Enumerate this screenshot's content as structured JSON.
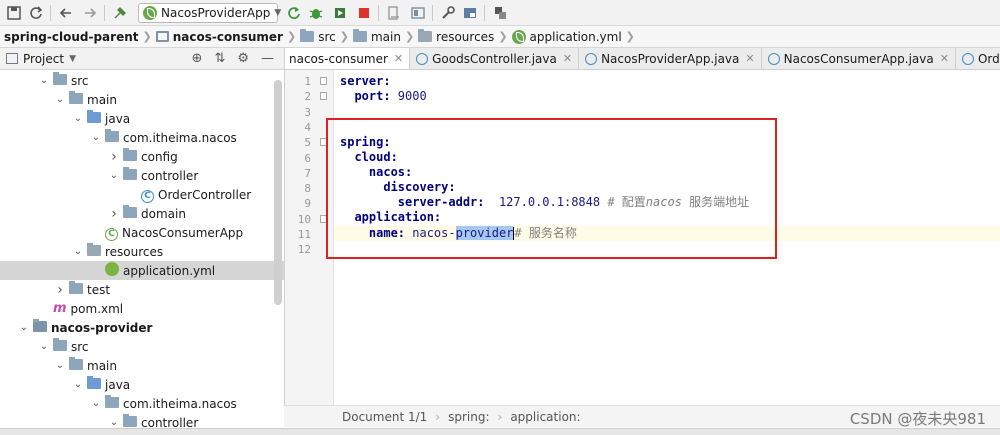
{
  "toolbar": {
    "run_config": "NacosProviderApp",
    "icons": [
      "save-icon",
      "sync-icon",
      "back-icon",
      "forward-icon",
      "build-icon",
      "run-icon",
      "debug-icon",
      "coverage-icon",
      "stop-icon",
      "structure-icon",
      "project-structure-icon",
      "settings-icon",
      "sdk-icon",
      "database-icon"
    ]
  },
  "breadcrumb": [
    {
      "label": "spring-cloud-parent",
      "bold": true
    },
    {
      "label": "nacos-consumer",
      "bold": true
    },
    {
      "label": "src"
    },
    {
      "label": "main"
    },
    {
      "label": "resources"
    },
    {
      "label": "application.yml"
    }
  ],
  "project_panel": {
    "title": "Project",
    "tree": [
      {
        "label": "src",
        "icon": "folder",
        "arrow": "v"
      },
      {
        "label": "main",
        "icon": "folder",
        "arrow": "v"
      },
      {
        "label": "java",
        "icon": "folder-blue",
        "arrow": "v"
      },
      {
        "label": "com.itheima.nacos",
        "icon": "package",
        "arrow": "v"
      },
      {
        "label": "config",
        "icon": "package",
        "arrow": ">"
      },
      {
        "label": "controller",
        "icon": "package",
        "arrow": "v"
      },
      {
        "label": "OrderController",
        "icon": "class",
        "arrow": ""
      },
      {
        "label": "domain",
        "icon": "package",
        "arrow": ">"
      },
      {
        "label": "NacosConsumerApp",
        "icon": "spring-class",
        "arrow": ""
      },
      {
        "label": "resources",
        "icon": "folder-res",
        "arrow": "v"
      },
      {
        "label": "application.yml",
        "icon": "yml",
        "arrow": "",
        "selected": true
      },
      {
        "label": "test",
        "icon": "folder",
        "arrow": ">"
      },
      {
        "label": "pom.xml",
        "icon": "maven",
        "arrow": ""
      },
      {
        "label": "nacos-provider",
        "icon": "module",
        "arrow": "v",
        "bold": true
      },
      {
        "label": "src",
        "icon": "folder",
        "arrow": "v"
      },
      {
        "label": "main",
        "icon": "folder",
        "arrow": "v"
      },
      {
        "label": "java",
        "icon": "folder-blue",
        "arrow": "v"
      },
      {
        "label": "com.itheima.nacos",
        "icon": "package",
        "arrow": "v"
      },
      {
        "label": "controller",
        "icon": "package",
        "arrow": "v"
      }
    ]
  },
  "editor_tabs": [
    {
      "label": "nacos-consumer",
      "active": true
    },
    {
      "label": "GoodsController.java"
    },
    {
      "label": "NacosProviderApp.java"
    },
    {
      "label": "NacosConsumerApp.java"
    },
    {
      "label": "OrderController.java"
    }
  ],
  "code": {
    "line_numbers": [
      "1",
      "2",
      "3",
      "4",
      "5",
      "6",
      "7",
      "8",
      "9",
      "10",
      "11",
      "12"
    ],
    "l1_key": "server:",
    "l2_key": "port:",
    "l2_val": " 9000",
    "l5_key": "spring:",
    "l6_key": "cloud:",
    "l7_key": "nacos:",
    "l8_key": "discovery:",
    "l9_key": "server-addr:",
    "l9_val": "  127.0.0.1:8848 ",
    "l9_comment_a": "# 配置",
    "l9_comment_b": "nacos",
    "l9_comment_c": " 服务端地址",
    "l10_key": "application:",
    "l11_key": "name:",
    "l11_val_a": " nacos-",
    "l11_val_sel": "provider",
    "l11_comment": "# 服务名称"
  },
  "status": {
    "document": "Document 1/1",
    "path_1": "spring:",
    "path_2": "application:"
  },
  "watermark": "CSDN @夜未央981",
  "colors": {
    "annotation_box": "#e02020",
    "yaml_key": "#000080",
    "selection": "#a6c7f0"
  }
}
